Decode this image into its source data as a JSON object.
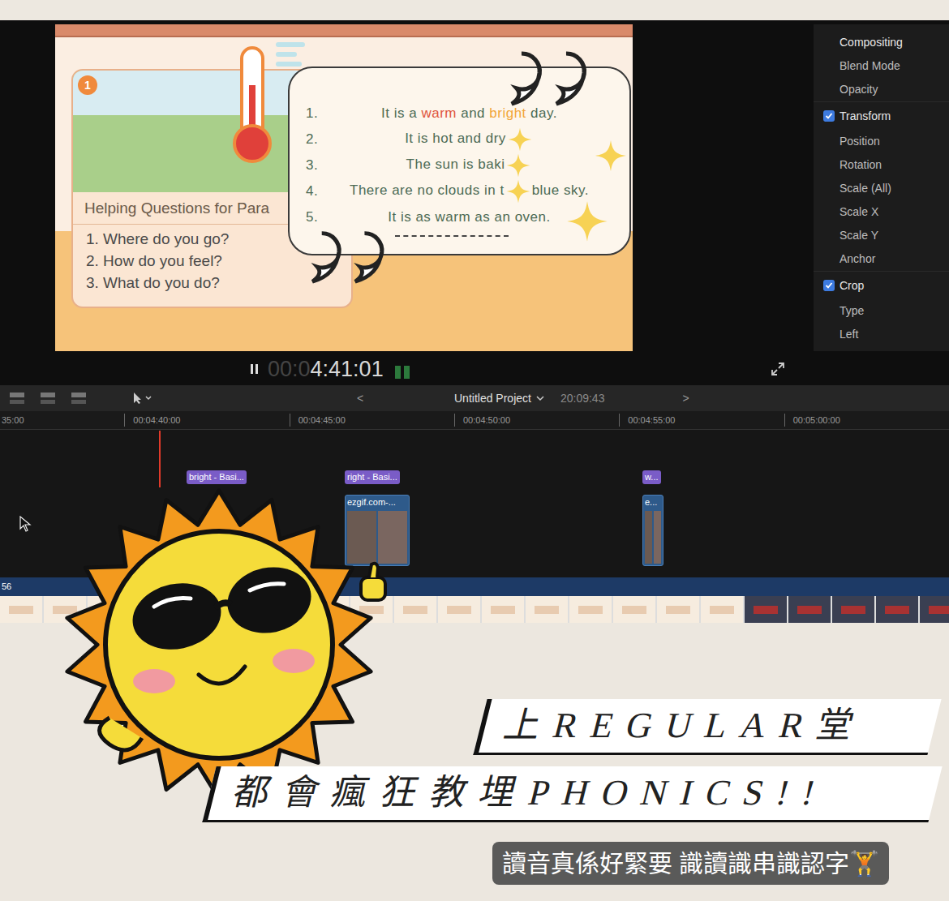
{
  "viewer": {
    "slide": {
      "badge": "1",
      "card_title": "Helping Questions for Para",
      "questions": [
        "1. Where do you go?",
        "2. How do you feel?",
        "3. What do you do?"
      ],
      "sentences": [
        {
          "number": "1.",
          "parts": [
            {
              "text": "It is a ",
              "color": "#4d6b55",
              "star_after": false
            },
            {
              "text": "warm",
              "color": "#e0553d",
              "star_after": false
            },
            {
              "text": " and ",
              "color": "#4d6b55",
              "star_after": false
            },
            {
              "text": "bright",
              "color": "#f2a53a",
              "star_after": false
            },
            {
              "text": " day.",
              "color": "#4d6b55",
              "star_after": false
            }
          ]
        },
        {
          "number": "2.",
          "parts": [
            {
              "text": "It is hot and dry",
              "color": "#4d6b55",
              "star_after": true
            }
          ]
        },
        {
          "number": "3.",
          "parts": [
            {
              "text": "The sun is baki",
              "color": "#4d6b55",
              "star_after": true
            }
          ]
        },
        {
          "number": "4.",
          "parts": [
            {
              "text": "There are no clouds in t",
              "color": "#4d6b55",
              "star_after": true
            },
            {
              "text": "blue sky.",
              "color": "#4d6b55",
              "star_after": false
            }
          ]
        },
        {
          "number": "5.",
          "parts": [
            {
              "text": "It is as warm as an oven.",
              "color": "#4d6b55",
              "star_after": false
            }
          ]
        }
      ]
    }
  },
  "inspector": {
    "compositing": {
      "title": "Compositing",
      "rows": [
        "Blend Mode",
        "Opacity"
      ]
    },
    "sections": [
      {
        "title": "Transform",
        "checked": true,
        "rows": [
          "Position",
          "Rotation",
          "Scale (All)",
          "Scale X",
          "Scale Y",
          "Anchor"
        ]
      },
      {
        "title": "Crop",
        "checked": true,
        "rows": [
          "Type",
          "Left"
        ]
      }
    ]
  },
  "playback": {
    "playing": true,
    "timecode_dim": "00:0",
    "timecode": "4:41:01"
  },
  "toolbar": {
    "prev": "<",
    "project": "Untitled Project",
    "duration": "20:09:43",
    "next": ">"
  },
  "timeline": {
    "ruler": [
      "35:00",
      "00:04:40:00",
      "00:04:45:00",
      "00:04:50:00",
      "00:04:55:00",
      "00:05:00:00"
    ],
    "clips": [
      {
        "label": "bright - Basi...",
        "kind": "title"
      },
      {
        "label": "right - Basi...",
        "kind": "title"
      },
      {
        "label": "ezgif.com-...",
        "kind": "video"
      },
      {
        "label": "w...",
        "kind": "title"
      },
      {
        "label": "e...",
        "kind": "video"
      }
    ],
    "storyline_label": "56"
  },
  "stickers": [
    "上REGULAR堂",
    "都會瘋狂教埋PHONICS!!"
  ],
  "caption": "讀音真係好緊要 識讀識串識認字🏋️"
}
